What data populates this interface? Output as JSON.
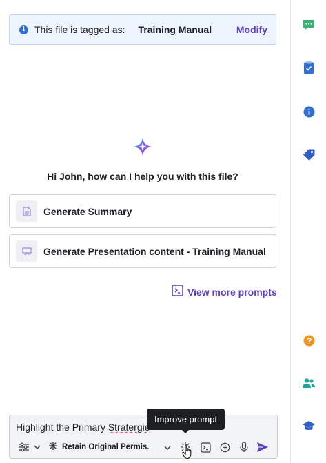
{
  "banner": {
    "text": "This file is tagged as:",
    "tag": "Training Manual",
    "action": "Modify"
  },
  "greeting": "Hi John, how can I help you with this file?",
  "prompts": [
    {
      "label": "Generate Summary",
      "icon": "document-icon"
    },
    {
      "label": "Generate Presentation content - Training Manual",
      "icon": "presentation-icon"
    }
  ],
  "view_more": "View more prompts",
  "composer": {
    "text_before": "Highlight the Primary ",
    "misspelled": "Stratergie",
    "permission_label": "Retain Original Permis...",
    "tooltip": "Improve prompt"
  },
  "rail": {
    "icons": [
      "chat-icon",
      "clipboard-check-icon",
      "info-icon",
      "tag-icon",
      "help-icon",
      "people-icon",
      "graduation-cap-icon"
    ]
  },
  "colors": {
    "accent": "#5b3fbf",
    "banner_bg": "#eef4fd",
    "info_blue": "#2f6fd6",
    "chat_green": "#3bb273",
    "help_orange": "#f0941e",
    "people_teal": "#1fa89a"
  }
}
